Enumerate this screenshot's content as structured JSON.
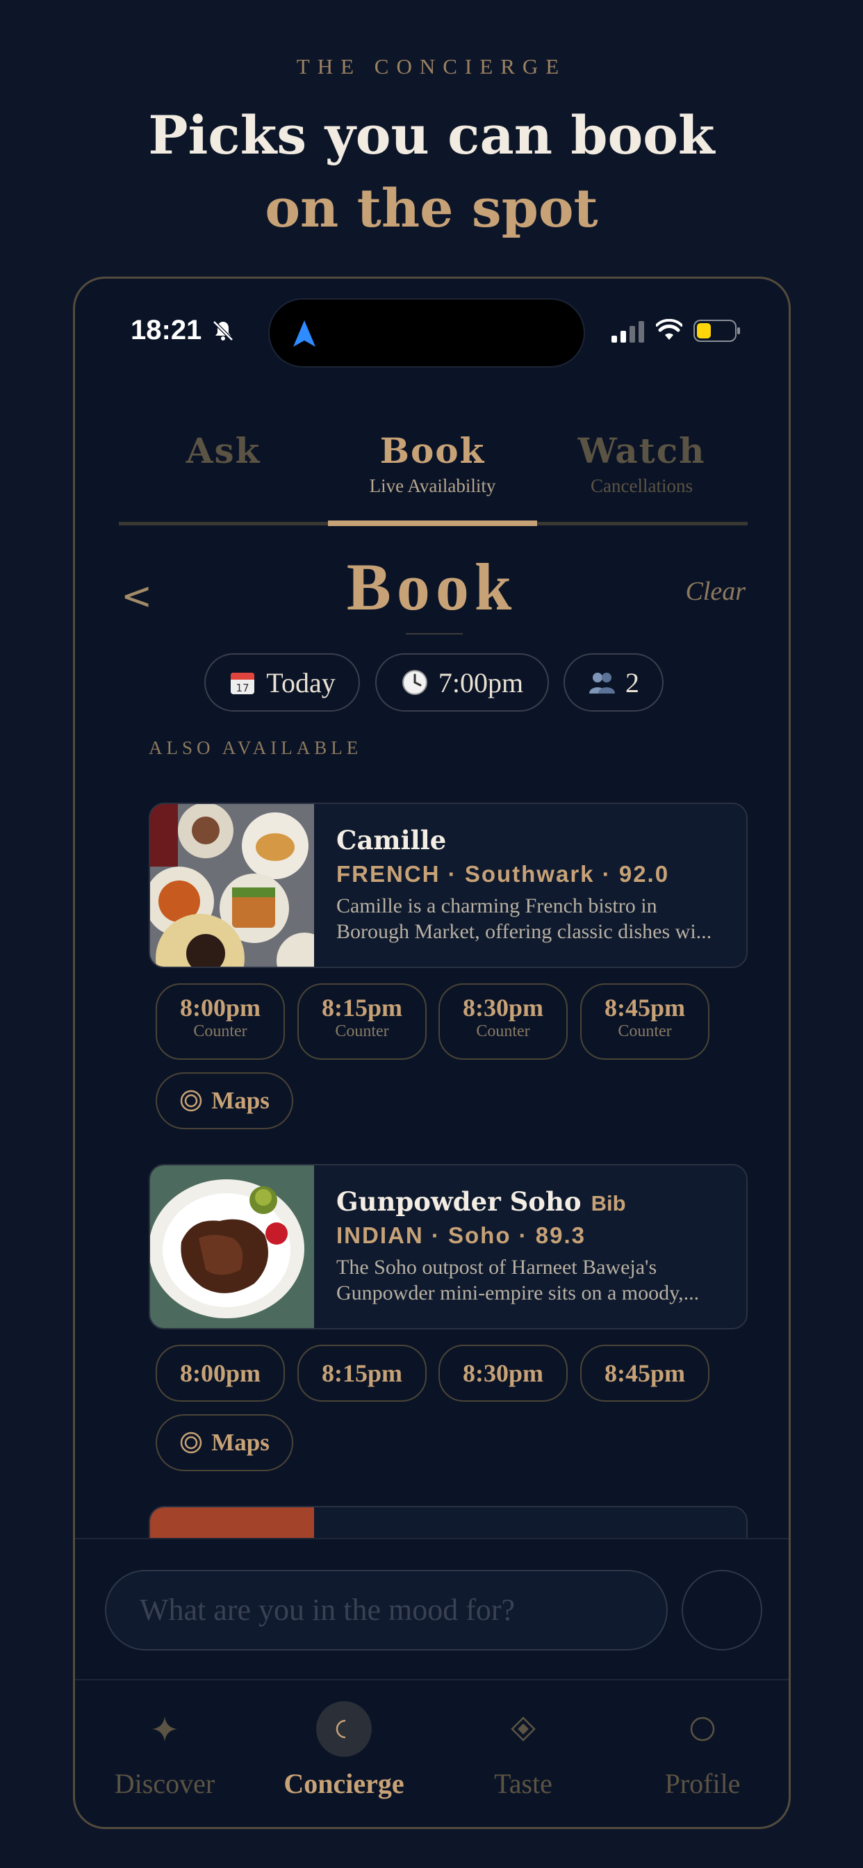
{
  "header": {
    "eyebrow": "THE   CONCIERGE",
    "title_line1": "Picks you can book",
    "title_line2": "on the spot"
  },
  "status_bar": {
    "time": "18:21"
  },
  "tabs": [
    {
      "title": "Ask",
      "subtitle": ""
    },
    {
      "title": "Book",
      "subtitle": "Live Availability"
    },
    {
      "title": "Watch",
      "subtitle": "Cancellations"
    }
  ],
  "active_tab": "Book",
  "page": {
    "back_label": "<",
    "title": "Book",
    "clear_label": "Clear"
  },
  "filters": {
    "date": "Today",
    "time": "7:00pm",
    "party": "2"
  },
  "section_label": "ALSO AVAILABLE",
  "restaurants": [
    {
      "name": "Camille",
      "badge": "",
      "meta": "FRENCH · Southwark · 92.0",
      "desc_line1": "Camille is a charming French bistro in",
      "desc_line2": "Borough Market, offering classic dishes wi...",
      "slots": [
        {
          "time": "8:00pm",
          "area": "Counter"
        },
        {
          "time": "8:15pm",
          "area": "Counter"
        },
        {
          "time": "8:30pm",
          "area": "Counter"
        },
        {
          "time": "8:45pm",
          "area": "Counter"
        }
      ],
      "maps_label": "Maps"
    },
    {
      "name": "Gunpowder Soho",
      "badge": "Bib",
      "meta": "INDIAN · Soho · 89.3",
      "desc_line1": "The Soho outpost of Harneet Baweja's",
      "desc_line2": "Gunpowder mini-empire sits on a moody,...",
      "slots": [
        {
          "time": "8:00pm"
        },
        {
          "time": "8:15pm"
        },
        {
          "time": "8:30pm"
        },
        {
          "time": "8:45pm"
        }
      ],
      "maps_label": "Maps"
    }
  ],
  "composer": {
    "placeholder": "What are you in the mood for?"
  },
  "tabbar": [
    {
      "label": "Discover",
      "icon": "sparkle-icon"
    },
    {
      "label": "Concierge",
      "icon": "crescent-icon"
    },
    {
      "label": "Taste",
      "icon": "diamond-icon"
    },
    {
      "label": "Profile",
      "icon": "profile-circle-icon"
    }
  ],
  "colors": {
    "background": "#0d1628",
    "accent": "#c8a277",
    "muted": "#5b5343"
  }
}
